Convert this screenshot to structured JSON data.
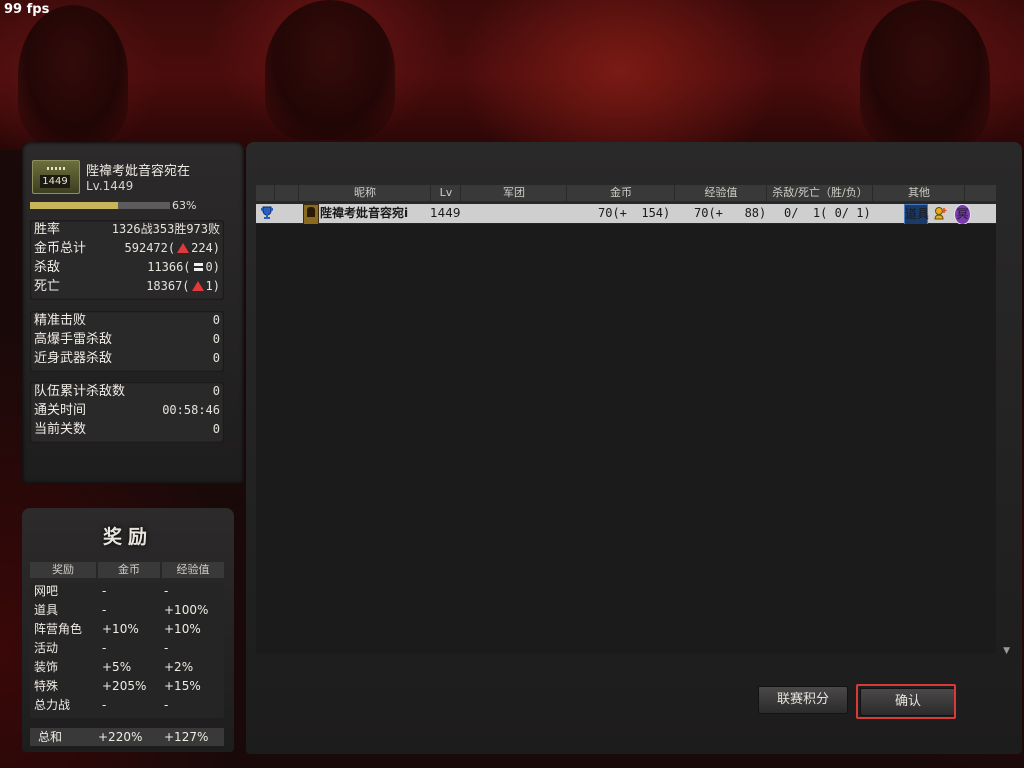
{
  "fps": "99 fps",
  "player": {
    "name": "陛禕考妣音容宛在",
    "level_text": "Lv.1449",
    "rank_badge_level": "1449",
    "xp_percent": 63,
    "xp_percent_text": "63%"
  },
  "stats_main": [
    {
      "label": "胜率",
      "value": "1326战353胜973败"
    },
    {
      "label": "金币总计",
      "value_prefix": "592472(",
      "indicator": "up",
      "value_suffix": "224)"
    },
    {
      "label": "杀敌",
      "value_prefix": "11366(",
      "indicator": "equal",
      "value_suffix": "0)"
    },
    {
      "label": "死亡",
      "value_prefix": "18367(",
      "indicator": "up",
      "value_suffix": "1)"
    }
  ],
  "stats_kills": [
    {
      "label": "精准击败",
      "value": "0"
    },
    {
      "label": "高爆手雷杀敌",
      "value": "0"
    },
    {
      "label": "近身武器杀敌",
      "value": "0"
    }
  ],
  "stats_team": [
    {
      "label": "队伍累计杀敌数",
      "value": "0"
    },
    {
      "label": "通关时间",
      "value": "00:58:46"
    },
    {
      "label": "当前关数",
      "value": "0"
    }
  ],
  "reward": {
    "title": "奖励",
    "headers": [
      "奖励",
      "金币",
      "经验值"
    ],
    "rows": [
      {
        "name": "网吧",
        "coin": "-",
        "exp": "-"
      },
      {
        "name": "道具",
        "coin": "-",
        "exp": "+100%"
      },
      {
        "name": "阵营角色",
        "coin": "+10%",
        "exp": "+10%"
      },
      {
        "name": "活动",
        "coin": "-",
        "exp": "-"
      },
      {
        "name": "装饰",
        "coin": "+5%",
        "exp": "+2%"
      },
      {
        "name": "特殊",
        "coin": "+205%",
        "exp": "+15%"
      },
      {
        "name": "总力战",
        "coin": "-",
        "exp": "-"
      }
    ],
    "total": {
      "name": "总和",
      "coin": "+220%",
      "exp": "+127%"
    }
  },
  "scoreboard": {
    "headers": {
      "nickname": "昵称",
      "lv": "Lv",
      "clan": "军团",
      "gold": "金币",
      "exp": "经验值",
      "kd": "杀敌/死亡（胜/负）",
      "other": "其他"
    },
    "rows": [
      {
        "nickname": "陛禕考妣音容宛i",
        "lv": "1449",
        "clan": "",
        "gold": "70(+  154)",
        "exp": "70(+   88)",
        "kd": "0/  1( 0/ 1)",
        "item_badge": "道具",
        "icons": [
          "trophy-icon",
          "class-icon",
          "item-badge",
          "boost-icon",
          "medal-icon"
        ]
      }
    ]
  },
  "buttons": {
    "league": "联赛积分",
    "confirm": "确认"
  },
  "colors": {
    "highlight_ring": "#d83a3a",
    "xp_fill": "#c8b55a",
    "up_arrow": "#e23a3a"
  }
}
